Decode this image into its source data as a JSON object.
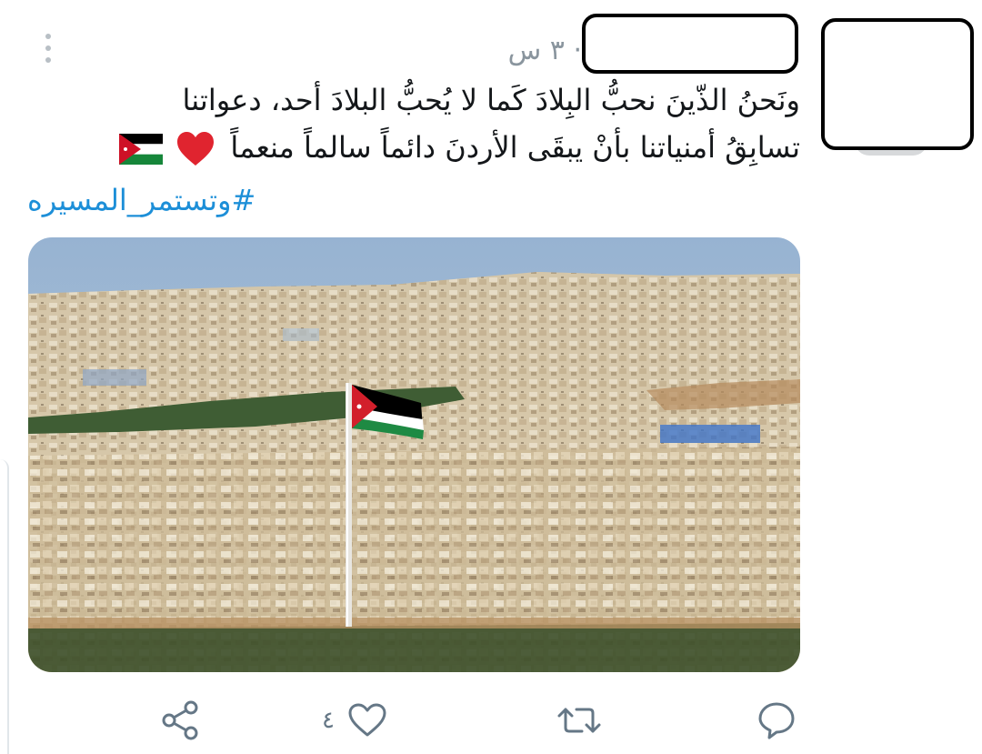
{
  "tweet": {
    "time": "٣ س",
    "time_dot": "·",
    "text_line1": "ونَحنُ الذّينَ نحبُّ البِلادَ كَما لا يُحبُّ البلادَ أحد، دعواتنا",
    "text_line2": "تسابِقُ أمنياتنا بأنْ يبقَى الأردنَ دائماً سالماً منعماً",
    "hashtag": "#وتستمر_المسيره"
  },
  "actions": {
    "like_count": "٤",
    "icons": [
      "reply-icon",
      "retweet-icon",
      "like-icon",
      "share-icon"
    ]
  },
  "colors": {
    "text": "#14171a",
    "meta": "#8a959e",
    "hashtag": "#1d8fd8",
    "icon": "#657786"
  }
}
